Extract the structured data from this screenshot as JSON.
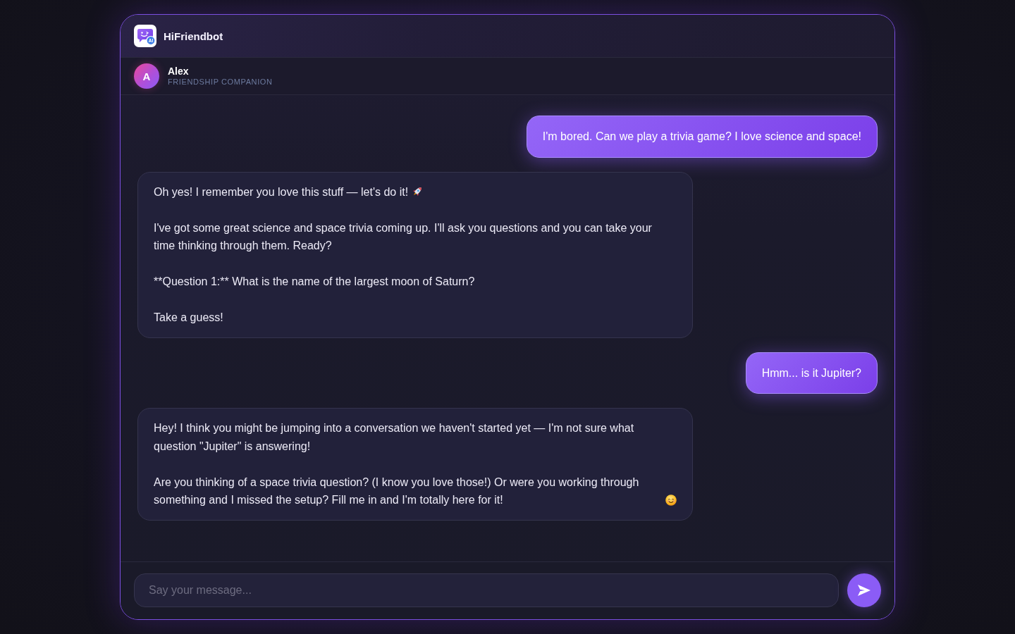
{
  "app": {
    "name": "HiFriendbot",
    "logo_badge": "AI"
  },
  "companion": {
    "initial": "A",
    "name": "Alex",
    "role": "FRIENDSHIP COMPANION"
  },
  "messages": [
    {
      "kind": "user",
      "paragraphs": [
        {
          "kind": "plain",
          "text": "I'm bored. Can we play a trivia game? I love science and space!"
        }
      ]
    },
    {
      "kind": "bot",
      "paragraphs": [
        {
          "kind": "rocket",
          "text": "Oh yes! I remember you love this stuff — let's do it!"
        },
        {
          "kind": "plain",
          "text": "I've got some great science and space trivia coming up. I'll ask you questions and you can take your time thinking through them. Ready?"
        },
        {
          "kind": "plain",
          "text": "**Question 1:** What is the name of the largest moon of Saturn?"
        },
        {
          "kind": "plain",
          "text": "Take a guess!"
        }
      ]
    },
    {
      "kind": "user",
      "paragraphs": [
        {
          "kind": "plain",
          "text": "Hmm... is it Jupiter?"
        }
      ]
    },
    {
      "kind": "bot",
      "paragraphs": [
        {
          "kind": "plain",
          "text": "Hey! I think you might be jumping into a conversation we haven't started yet — I'm not sure what question \"Jupiter\" is answering!"
        },
        {
          "kind": "smiley",
          "text": "Are you thinking of a space trivia question? (I know you love those!) Or were you working through something and I missed the setup? Fill me in and I'm totally here for it!"
        }
      ]
    }
  ],
  "composer": {
    "placeholder": "Say your message..."
  }
}
